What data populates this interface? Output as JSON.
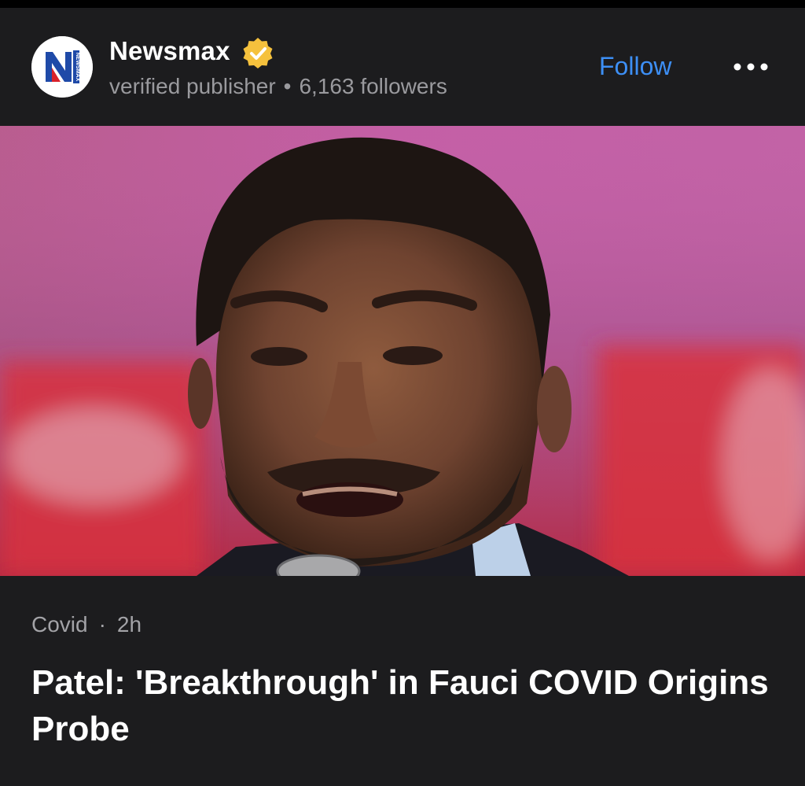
{
  "publisher": {
    "name": "Newsmax",
    "logo_text": "NEWSMAX",
    "logo_letter": "N",
    "status": "verified publisher",
    "followers": "6,163 followers",
    "badge_icon": "verified-check-icon",
    "badge_color": "#f5c13d"
  },
  "actions": {
    "follow_label": "Follow",
    "more_icon": "more-horizontal-icon"
  },
  "hero": {
    "icon": "article-photo"
  },
  "article": {
    "category": "Covid",
    "age": "2h",
    "headline": "Patel: 'Breakthrough' in Fauci COVID Origins Probe"
  },
  "colors": {
    "accent": "#3d8ff5",
    "background": "#1c1c1e",
    "secondary_text": "#9a9a9e"
  }
}
